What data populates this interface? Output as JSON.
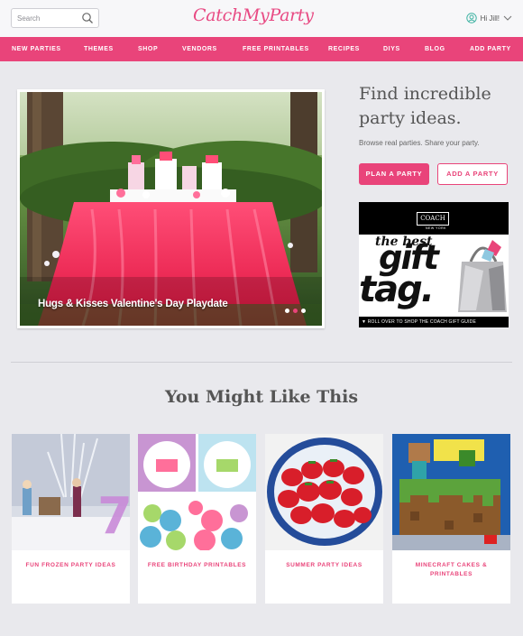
{
  "header": {
    "search_placeholder": "Search",
    "logo": "CatchMyParty",
    "user_greeting": "Hi Jill!"
  },
  "nav": {
    "items": [
      "NEW PARTIES",
      "THEMES",
      "SHOP",
      "VENDORS",
      "FREE PRINTABLES",
      "RECIPES",
      "DIYS",
      "BLOG",
      "ADD PARTY"
    ]
  },
  "hero": {
    "caption": "Hugs & Kisses Valentine's Day Playdate",
    "slide_count": 3,
    "active_slide": 2
  },
  "intro": {
    "headline": "Find incredible party ideas.",
    "subtext": "Browse real parties. Share your party.",
    "plan_button": "PLAN A PARTY",
    "add_button": "ADD A PARTY"
  },
  "ad": {
    "brand": "COACH",
    "brand_sub": "NEW YORK",
    "line1": "the best",
    "line2": "gift",
    "line3": "tag.",
    "cta": "▼ ROLL OVER TO SHOP THE COACH GIFT GUIDE"
  },
  "recommendations": {
    "title": "You Might Like This",
    "cards": [
      {
        "label": "FUN FROZEN PARTY IDEAS"
      },
      {
        "label": "FREE BIRTHDAY PRINTABLES"
      },
      {
        "label": "SUMMER PARTY IDEAS"
      },
      {
        "label": "MINECRAFT CAKES & PRINTABLES"
      }
    ]
  },
  "colors": {
    "brand_pink": "#e9447a",
    "page_bg": "#e9e9ed",
    "topbar_bg": "#f7f7f9"
  }
}
